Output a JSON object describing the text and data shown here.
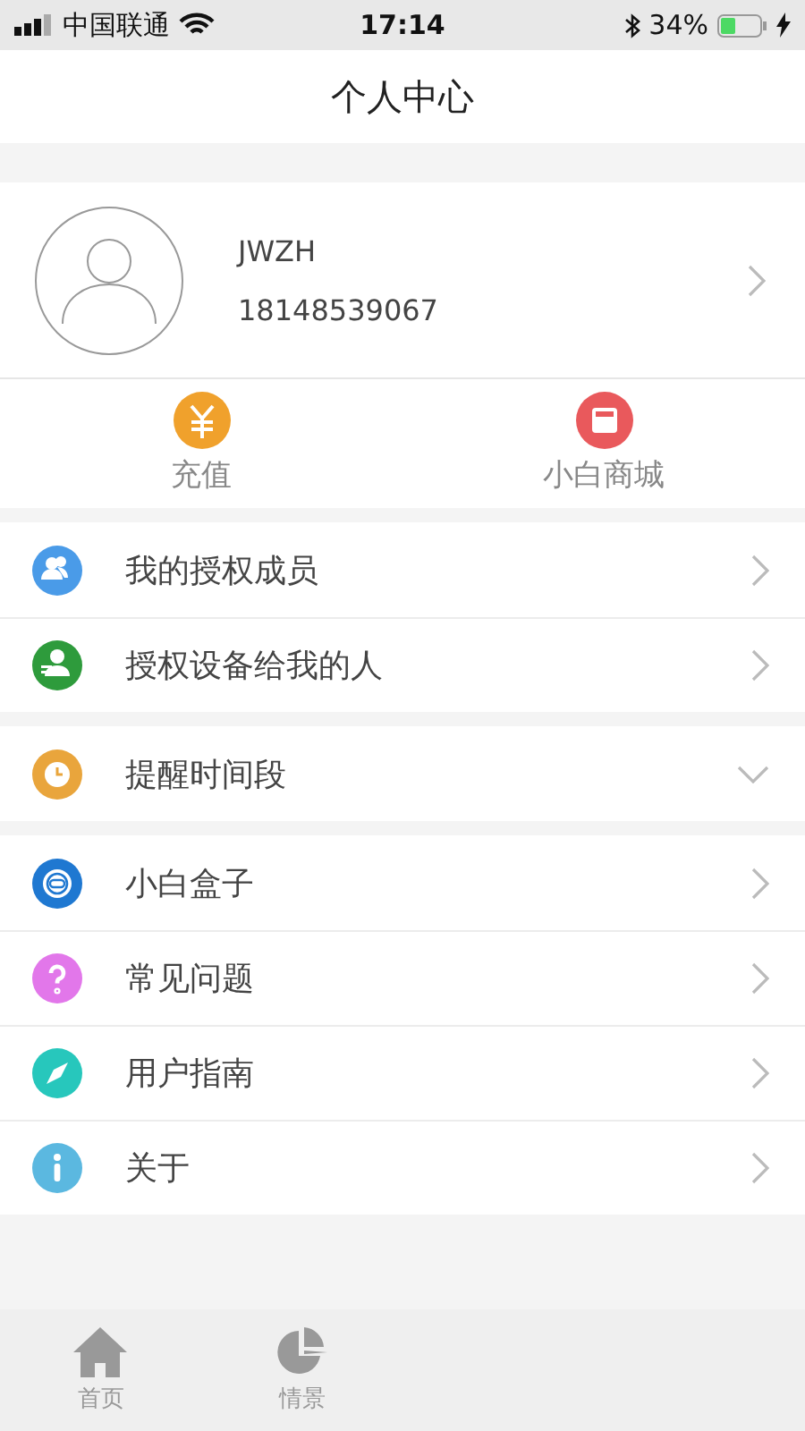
{
  "status_bar": {
    "carrier": "中国联通",
    "time": "17:14",
    "battery": "34%"
  },
  "nav": {
    "title": "个人中心"
  },
  "profile": {
    "name": "JWZH",
    "phone": "18148539067"
  },
  "quick_actions": [
    {
      "label": "充值"
    },
    {
      "label": "小白商城"
    }
  ],
  "groups": [
    {
      "items": [
        {
          "label": "我的授权成员"
        },
        {
          "label": "授权设备给我的人"
        }
      ]
    },
    {
      "items": [
        {
          "label": "提醒时间段",
          "expanded": false
        }
      ]
    },
    {
      "items": [
        {
          "label": "小白盒子"
        },
        {
          "label": "常见问题"
        },
        {
          "label": "用户指南"
        },
        {
          "label": "关于"
        }
      ]
    }
  ],
  "tab_bar": [
    {
      "label": "首页"
    },
    {
      "label": "情景"
    }
  ]
}
